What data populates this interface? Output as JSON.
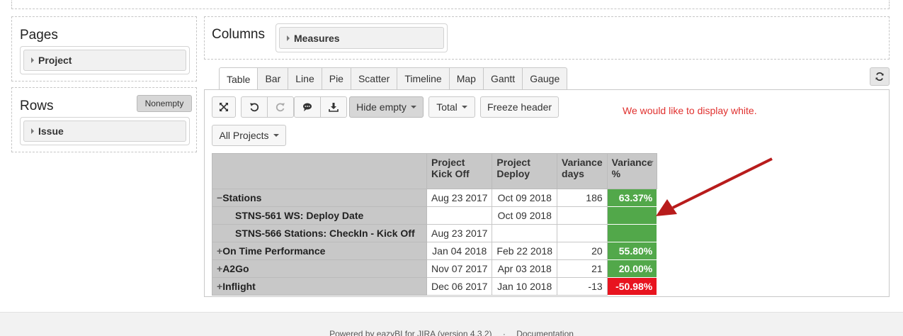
{
  "pages": {
    "title": "Pages",
    "chip": "Project"
  },
  "rows": {
    "title": "Rows",
    "nonempty_label": "Nonempty",
    "chip": "Issue"
  },
  "columns": {
    "title": "Columns",
    "chip": "Measures"
  },
  "tabs": [
    "Table",
    "Bar",
    "Line",
    "Pie",
    "Scatter",
    "Timeline",
    "Map",
    "Gantt",
    "Gauge"
  ],
  "active_tab": "Table",
  "toolbar": {
    "hide_empty": "Hide empty",
    "total": "Total",
    "freeze_header": "Freeze header",
    "all_projects": "All Projects"
  },
  "note": "We would like to display white.",
  "colors": {
    "positive": "#52a84a",
    "negative": "#e8141f",
    "note": "#e0302e",
    "arrow": "#b81c1c"
  },
  "table": {
    "headers": [
      {
        "l1": "Project",
        "l2": "Kick Off"
      },
      {
        "l1": "Project",
        "l2": "Deploy"
      },
      {
        "l1": "Variance",
        "l2": "days"
      },
      {
        "l1": "Variance",
        "l2": "%"
      }
    ],
    "rows": [
      {
        "prefix": "−",
        "label": "Stations",
        "kickoff": "Aug 23 2017",
        "deploy": "Oct 09 2018",
        "days": "186",
        "pct": "63.37%",
        "status": "positive"
      },
      {
        "prefix": "",
        "label": "STNS-561 WS: Deploy Date",
        "kickoff": "",
        "deploy": "Oct 09 2018",
        "days": "",
        "pct": "",
        "status": "positive"
      },
      {
        "prefix": "",
        "label": "STNS-566 Stations: CheckIn - Kick Off",
        "kickoff": "Aug 23 2017",
        "deploy": "",
        "days": "",
        "pct": "",
        "status": "positive"
      },
      {
        "prefix": "+",
        "label": "On Time Performance",
        "kickoff": "Jan 04 2018",
        "deploy": "Feb 22 2018",
        "days": "20",
        "pct": "55.80%",
        "status": "positive"
      },
      {
        "prefix": "+",
        "label": "A2Go",
        "kickoff": "Nov 07 2017",
        "deploy": "Apr 03 2018",
        "days": "21",
        "pct": "20.00%",
        "status": "positive"
      },
      {
        "prefix": "+",
        "label": "Inflight",
        "kickoff": "Dec 06 2017",
        "deploy": "Jan 10 2018",
        "days": "-13",
        "pct": "-50.98%",
        "status": "negative"
      }
    ]
  },
  "footer": {
    "powered": "Powered by eazyBI for JIRA (version 4.3.2)",
    "sep": "·",
    "docs": "Documentation"
  }
}
